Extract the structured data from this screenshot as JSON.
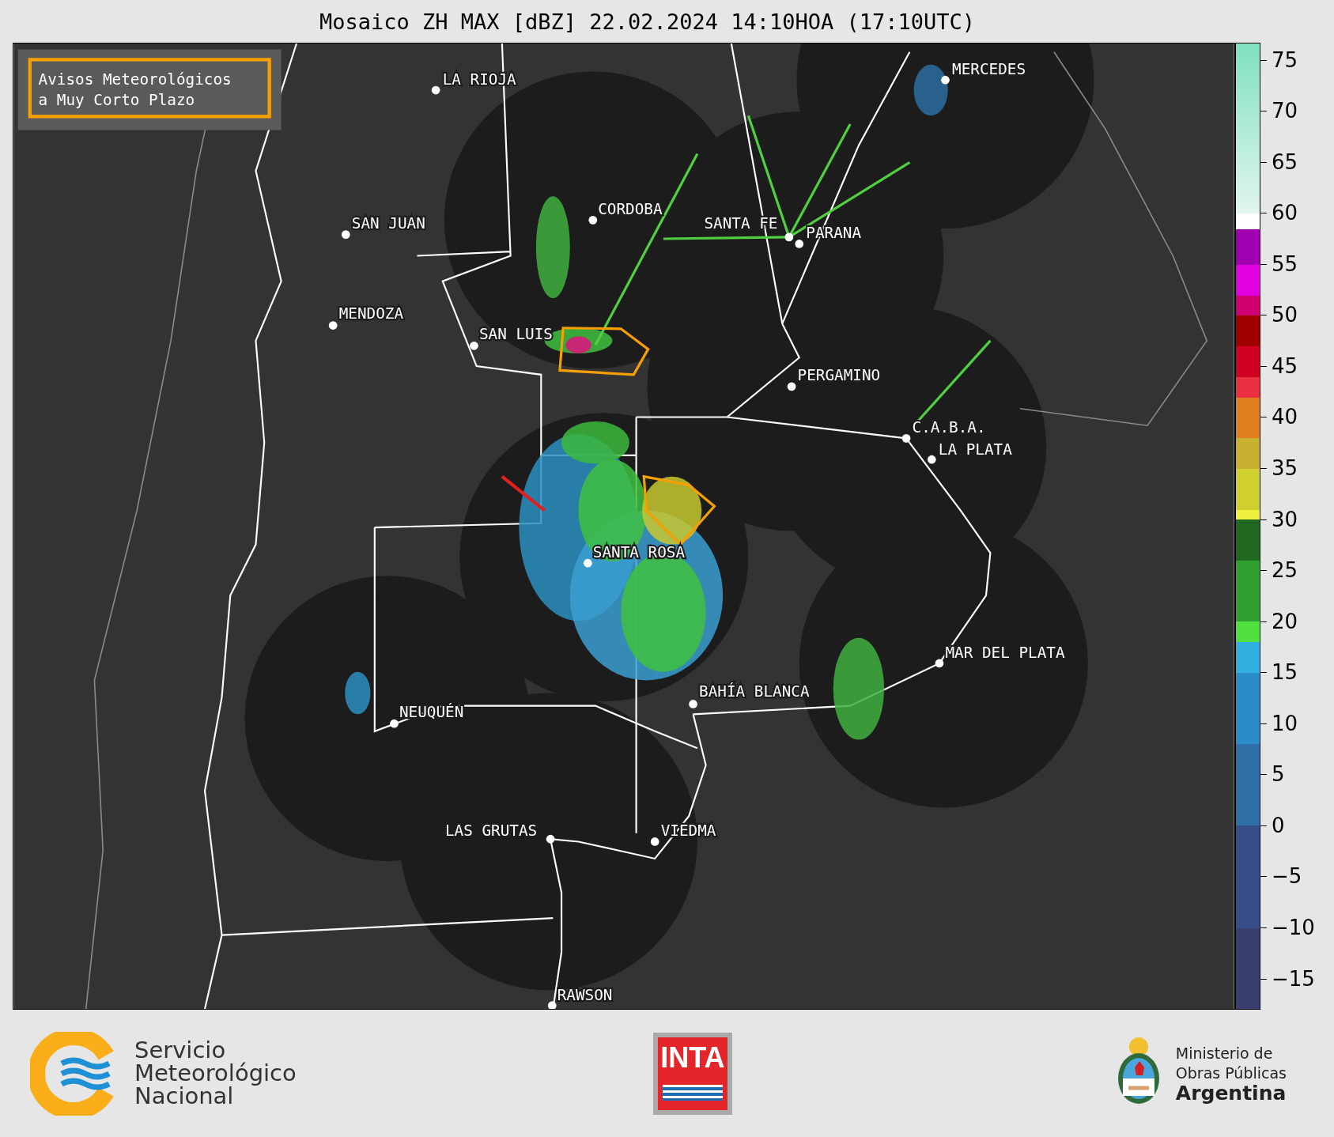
{
  "title": "Mosaico ZH MAX [dBZ] 22.02.2024 14:10HOA (17:10UTC)",
  "warning_legend": {
    "lines": [
      "Avisos Meteorológicos",
      "a Muy Corto Plazo"
    ]
  },
  "cities": [
    {
      "name": "LA RIOJA"
    },
    {
      "name": "MERCEDES"
    },
    {
      "name": "CORDOBA"
    },
    {
      "name": "SAN JUAN"
    },
    {
      "name": "SANTA FE"
    },
    {
      "name": "PARANA"
    },
    {
      "name": "MENDOZA"
    },
    {
      "name": "SAN LUIS"
    },
    {
      "name": "PERGAMINO"
    },
    {
      "name": "C.A.B.A."
    },
    {
      "name": "LA PLATA"
    },
    {
      "name": "SANTA ROSA"
    },
    {
      "name": "MAR DEL PLATA"
    },
    {
      "name": "BAHÍA BLANCA"
    },
    {
      "name": "NEUQUÉN"
    },
    {
      "name": "LAS GRUTAS"
    },
    {
      "name": "VIEDMA"
    },
    {
      "name": "RAWSON"
    }
  ],
  "colorbar": {
    "ticks": [
      "75",
      "70",
      "65",
      "60",
      "55",
      "50",
      "45",
      "40",
      "35",
      "30",
      "25",
      "20",
      "15",
      "10",
      "5",
      "0",
      "−5",
      "−10",
      "−15"
    ]
  },
  "footer": {
    "smn": {
      "lines": [
        "Servicio",
        "Meteorológico",
        "Nacional"
      ]
    },
    "inta": {
      "text": "INTA"
    },
    "ministry": {
      "lines": [
        "Ministerio de",
        "Obras Públicas",
        "Argentina"
      ]
    }
  }
}
